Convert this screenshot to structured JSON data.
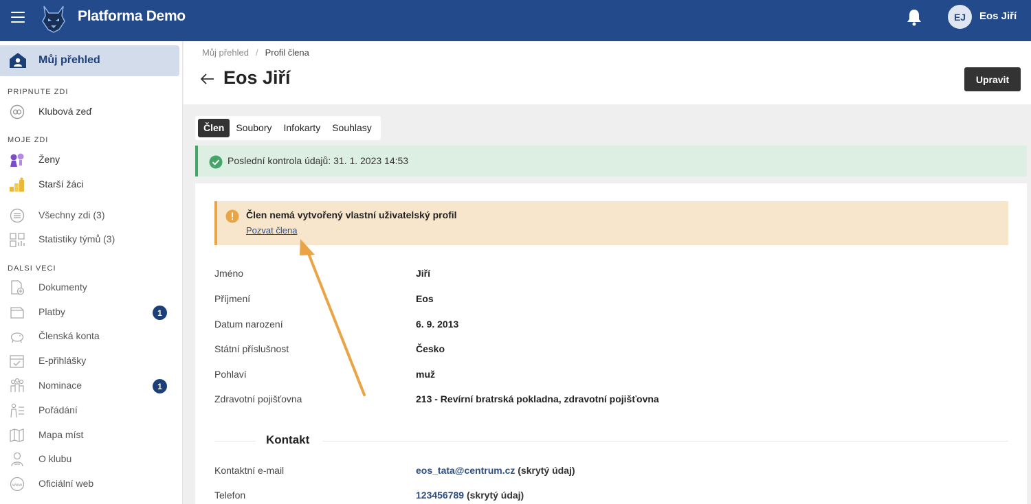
{
  "header": {
    "app_title": "Platforma Demo",
    "user_initials": "EJ",
    "user_name": "Eos Jiří"
  },
  "sidebar": {
    "active": {
      "label": "Můj přehled",
      "icon": "home-icon"
    },
    "sections": {
      "pinned": "PRIPNUTE ZDI",
      "my_walls": "MOJE ZDI",
      "other": "DALSI VECI"
    },
    "pinned_items": [
      {
        "label": "Klubová zeď",
        "icon": "club-wall-icon"
      }
    ],
    "wall_items": [
      {
        "label": "Ženy",
        "icon": "women-icon"
      },
      {
        "label": "Starší žáci",
        "icon": "older-pupils-icon"
      },
      {
        "label": "Všechny zdi (3)",
        "icon": "list-icon"
      },
      {
        "label": "Statistiky týmů (3)",
        "icon": "team-stats-icon"
      }
    ],
    "other_items": [
      {
        "label": "Dokumenty",
        "icon": "documents-icon"
      },
      {
        "label": "Platby",
        "icon": "payments-icon",
        "badge": "1"
      },
      {
        "label": "Členská konta",
        "icon": "piggy-bank-icon"
      },
      {
        "label": "E-přihlášky",
        "icon": "calendar-check-icon"
      },
      {
        "label": "Nominace",
        "icon": "nomination-icon",
        "badge": "1"
      },
      {
        "label": "Pořádání",
        "icon": "organizing-icon"
      },
      {
        "label": "Mapa míst",
        "icon": "map-icon"
      },
      {
        "label": "O klubu",
        "icon": "about-club-icon"
      },
      {
        "label": "Oficiální web",
        "icon": "www-icon"
      }
    ]
  },
  "breadcrumb": {
    "root": "Můj přehled",
    "separator": "/",
    "current": "Profil člena"
  },
  "page": {
    "title": "Eos Jiří",
    "edit_label": "Upravit"
  },
  "tabs": [
    "Člen",
    "Soubory",
    "Infokarty",
    "Souhlasy"
  ],
  "success_alert": {
    "text": "Poslední kontrola údajů: 31. 1. 2023 14:53"
  },
  "warning_alert": {
    "title": "Člen nemá vytvořený vlastní uživatelský profil",
    "link": "Pozvat člena"
  },
  "details": [
    {
      "key": "Jméno",
      "value": "Jiří"
    },
    {
      "key": "Příjmení",
      "value": "Eos"
    },
    {
      "key": "Datum narození",
      "value": "6. 9. 2013"
    },
    {
      "key": "Státní příslušnost",
      "value": "Česko"
    },
    {
      "key": "Pohlaví",
      "value": "muž"
    },
    {
      "key": "Zdravotní pojišťovna",
      "value": "213 - Revírní bratrská pokladna, zdravotní pojišťovna"
    }
  ],
  "contact": {
    "title": "Kontakt",
    "email_label": "Kontaktní e-mail",
    "email_value": "eos_tata@centrum.cz",
    "email_note": "(skrytý údaj)",
    "phone_label": "Telefon",
    "phone_value": "123456789",
    "phone_note": "(skrytý údaj)"
  },
  "colors": {
    "brand": "#234a8a",
    "success": "#45a46a",
    "warning": "#e8a445",
    "annotation_arrow": "#eba445"
  }
}
